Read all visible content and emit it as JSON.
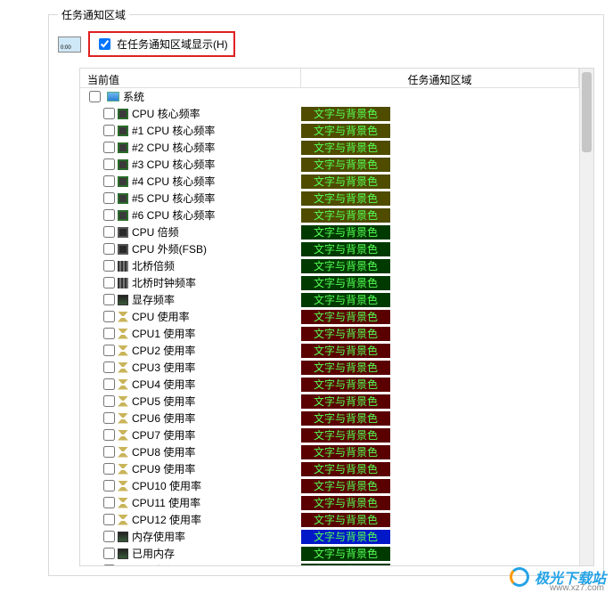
{
  "group_title": "任务通知区域",
  "top_checkbox": {
    "label": "在任务通知区域显示(H)",
    "checked": true
  },
  "headers": {
    "col1": "当前值",
    "col2": "任务通知区域"
  },
  "root_label": "系统",
  "badge_text": "文字与背景色",
  "rows": [
    {
      "label": "CPU 核心频率",
      "icon": "ic-chip",
      "bg": "#4f4c00"
    },
    {
      "label": "#1 CPU 核心频率",
      "icon": "ic-chip",
      "bg": "#4f4c00"
    },
    {
      "label": "#2 CPU 核心频率",
      "icon": "ic-chip",
      "bg": "#4f4c00"
    },
    {
      "label": "#3 CPU 核心频率",
      "icon": "ic-chip",
      "bg": "#4f4c00"
    },
    {
      "label": "#4 CPU 核心频率",
      "icon": "ic-chip",
      "bg": "#4f4c00"
    },
    {
      "label": "#5 CPU 核心频率",
      "icon": "ic-chip",
      "bg": "#4f4c00"
    },
    {
      "label": "#6 CPU 核心频率",
      "icon": "ic-chip",
      "bg": "#4f4c00"
    },
    {
      "label": "CPU 倍频",
      "icon": "ic-chip-dark",
      "bg": "#003a00"
    },
    {
      "label": "CPU 外频(FSB)",
      "icon": "ic-chip-dark",
      "bg": "#003a00"
    },
    {
      "label": "北桥倍频",
      "icon": "ic-bars",
      "bg": "#003a00"
    },
    {
      "label": "北桥时钟频率",
      "icon": "ic-bars",
      "bg": "#003a00"
    },
    {
      "label": "显存频率",
      "icon": "ic-mem",
      "bg": "#003a00"
    },
    {
      "label": "CPU 使用率",
      "icon": "ic-hourglass-r",
      "bg": "#5a0000"
    },
    {
      "label": "CPU1 使用率",
      "icon": "ic-hourglass-r",
      "bg": "#5a0000"
    },
    {
      "label": "CPU2 使用率",
      "icon": "ic-hourglass-r",
      "bg": "#5a0000"
    },
    {
      "label": "CPU3 使用率",
      "icon": "ic-hourglass-r",
      "bg": "#5a0000"
    },
    {
      "label": "CPU4 使用率",
      "icon": "ic-hourglass-r",
      "bg": "#5a0000"
    },
    {
      "label": "CPU5 使用率",
      "icon": "ic-hourglass-r",
      "bg": "#5a0000"
    },
    {
      "label": "CPU6 使用率",
      "icon": "ic-hourglass-r",
      "bg": "#5a0000"
    },
    {
      "label": "CPU7 使用率",
      "icon": "ic-hourglass-r",
      "bg": "#5a0000"
    },
    {
      "label": "CPU8 使用率",
      "icon": "ic-hourglass-r",
      "bg": "#5a0000"
    },
    {
      "label": "CPU9 使用率",
      "icon": "ic-hourglass-r",
      "bg": "#5a0000"
    },
    {
      "label": "CPU10 使用率",
      "icon": "ic-hourglass-r",
      "bg": "#5a0000"
    },
    {
      "label": "CPU11 使用率",
      "icon": "ic-hourglass-r",
      "bg": "#5a0000"
    },
    {
      "label": "CPU12 使用率",
      "icon": "ic-hourglass-r",
      "bg": "#5a0000"
    },
    {
      "label": "内存使用率",
      "icon": "ic-mem",
      "bg": "#0018c8"
    },
    {
      "label": "已用内存",
      "icon": "ic-mem",
      "bg": "#003a00"
    },
    {
      "label": "可用内存",
      "icon": "ic-mem",
      "bg": "#003a00"
    }
  ],
  "watermark": {
    "text": "极光下载站",
    "url": "www.xz7.com"
  }
}
